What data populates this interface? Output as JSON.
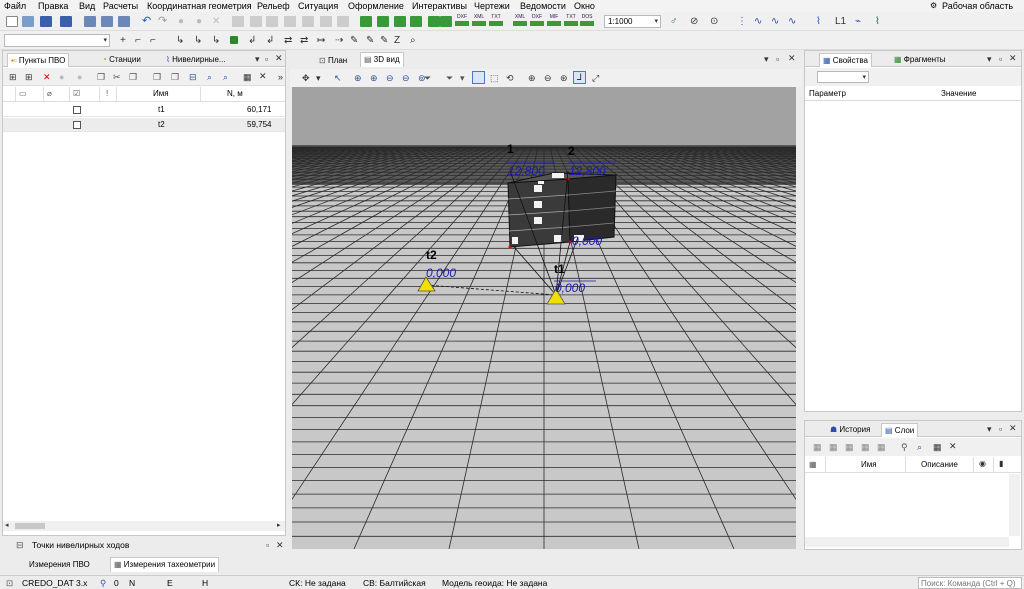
{
  "menu": [
    "Файл",
    "Правка",
    "Вид",
    "Расчеты",
    "Координатная геометрия",
    "Рельеф",
    "Ситуация",
    "Оформление",
    "Интерактивы",
    "Чертежи",
    "Ведомости",
    "Окно"
  ],
  "workspace": "Рабочая область",
  "toolbar": {
    "scale": "1:1000",
    "export_labels": [
      "DXF",
      "XML",
      "TXT",
      "XML",
      "DXF",
      "MIF",
      "TXT",
      "DOS"
    ],
    "layer_select": "",
    "lambda_label": "L1"
  },
  "left_panel": {
    "tabs": [
      "Пункты ПВО",
      "Станции",
      "Нивелирные..."
    ],
    "columns": [
      "Имя",
      "N, м"
    ],
    "rows": [
      {
        "name": "t1",
        "value": "60,171"
      },
      {
        "name": "t2",
        "value": "59,754"
      }
    ],
    "bottom_title": "Точки нивелирных ходов",
    "bottom_tabs": [
      "Измерения ПВО",
      "Измерения тахеометрии"
    ]
  },
  "center": {
    "tabs": [
      "План",
      "3D вид"
    ],
    "labels": {
      "p1_name": "1",
      "p1_val": "12,800",
      "p2_name": "2",
      "p2_val": "12,800",
      "box_val": "0,000",
      "t2_name": "t2",
      "t2_val": "0,000",
      "t1_name": "t1",
      "t1_val": "0,000"
    }
  },
  "right_panel": {
    "tabs": [
      "Свойства",
      "Фрагменты"
    ],
    "columns": [
      "Параметр",
      "Значение"
    ],
    "bottom_tabs": [
      "История",
      "Слои"
    ],
    "layer_columns": [
      "Имя",
      "Описание"
    ]
  },
  "statusbar": {
    "app": "CREDO_DAT 3.x",
    "n": "N",
    "e": "E",
    "h": "H",
    "zero": "0",
    "sk": "СК: Не задана",
    "sv": "СВ: Балтийская",
    "geoid": "Модель геоида: Не задана",
    "search_placeholder": "Поиск: Команда (Ctrl + Q)"
  },
  "colors": {
    "accent": "#1f3fc4",
    "label_blue": "#1a1ab0",
    "triangle": "#f0e000",
    "panel_border": "#c8c8c8"
  }
}
